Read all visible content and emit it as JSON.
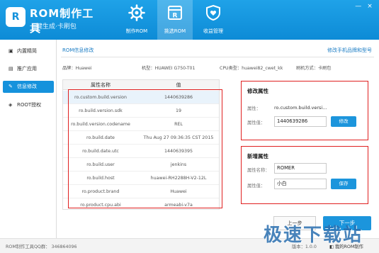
{
  "app": {
    "logo_title": "ROM制作工具",
    "logo_subtitle": "一键生成·卡刷包",
    "window_controls": [
      "—",
      "×"
    ]
  },
  "top_tabs": [
    {
      "label": "制作ROM",
      "icon": "gear-icon"
    },
    {
      "label": "挑选ROM",
      "icon": "rom-package-icon"
    },
    {
      "label": "收益管理",
      "icon": "heart-shield-icon"
    }
  ],
  "sidebar": {
    "items": [
      {
        "label": "内置精简",
        "icon": "box-icon"
      },
      {
        "label": "推广应用",
        "icon": "app-icon"
      },
      {
        "label": "信息修改",
        "icon": "edit-icon"
      },
      {
        "label": "ROOT授权",
        "icon": "root-icon"
      }
    ]
  },
  "main": {
    "title": "ROM信息修改",
    "right_link": "修改手机品牌和型号",
    "device_info": [
      {
        "label": "品牌：",
        "value": "Huawei"
      },
      {
        "label": "机型：",
        "value": "HUAWEI G750-T01"
      },
      {
        "label": "CPU类型：",
        "value": "huawei82_cwet_kk"
      },
      {
        "label": "刷机方式：",
        "value": "卡刷包"
      }
    ]
  },
  "table": {
    "columns": [
      "属性名称",
      "值"
    ],
    "rows": [
      {
        "name": "ro.custom.build.version",
        "value": "1440639286"
      },
      {
        "name": "ro.build.version.sdk",
        "value": "19"
      },
      {
        "name": "ro.build.version.codename",
        "value": "REL"
      },
      {
        "name": "ro.build.date",
        "value": "Thu Aug 27 09:36:35 CST 2015"
      },
      {
        "name": "ro.build.date.utc",
        "value": "1440639395"
      },
      {
        "name": "ro.build.user",
        "value": "jenkins"
      },
      {
        "name": "ro.build.host",
        "value": "huawei-RH2288H-V2-12L"
      },
      {
        "name": "ro.product.brand",
        "value": "Huawei"
      },
      {
        "name": "ro.product.cpu.abi",
        "value": "armeabi-v7a"
      }
    ]
  },
  "edit_panel": {
    "title": "修改属性",
    "name_label": "属性：",
    "name_value": "ro.custom.build.versi...",
    "value_label": "属性值：",
    "value_input": "1440639286",
    "button": "修改"
  },
  "add_panel": {
    "title": "新增属性",
    "name_label": "属性名称：",
    "name_input": "ROMER",
    "value_label": "属性值：",
    "value_input": "小白",
    "button": "保存"
  },
  "actions": {
    "prev": "上一步",
    "next": "下一步"
  },
  "footer": {
    "qq_label": "ROM制作工具QQ群：",
    "qq_value": "346864096",
    "version": "版本：1.0.0",
    "link": "我的ROM制作"
  },
  "watermark": "极速下载站",
  "colors": {
    "header_blue": "#1592dc",
    "highlight_red": "#e02020",
    "button_blue": "#1c95dc"
  }
}
